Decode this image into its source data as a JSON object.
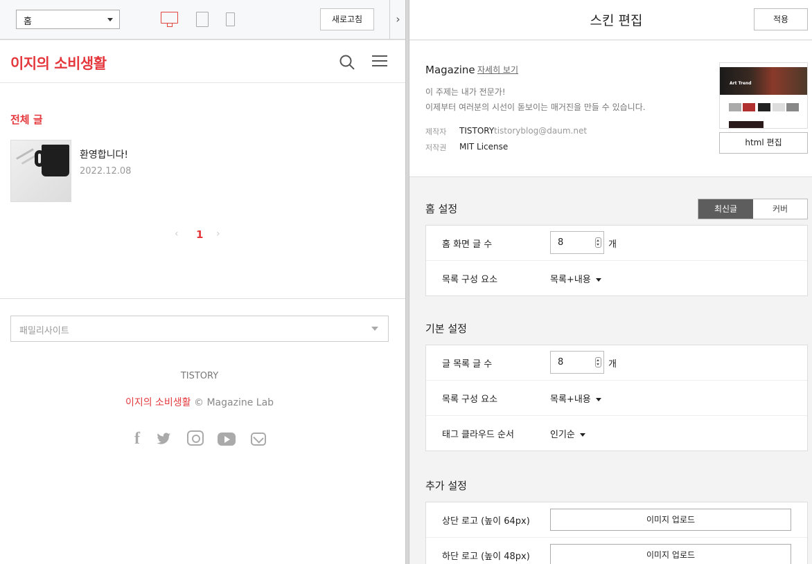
{
  "toolbar": {
    "page_select_value": "홈",
    "refresh_label": "새로고침",
    "collapse_glyph": "›"
  },
  "blog": {
    "title": "이지의 소비생활",
    "section_title": "전체 글",
    "posts": [
      {
        "title": "환영합니다!",
        "date": "2022.12.08"
      }
    ],
    "pager": {
      "prev": "‹",
      "current": "1",
      "next": "›"
    },
    "footer": {
      "family_site_placeholder": "패밀리사이트",
      "tistory": "TISTORY",
      "blog_name": "이지의 소비생활",
      "copyright": " © Magazine Lab"
    },
    "social_icons": [
      "facebook-icon",
      "twitter-icon",
      "instagram-icon",
      "youtube-icon",
      "mail-icon"
    ],
    "social_glyphs": {
      "facebook": "f",
      "twitter": "🐦"
    }
  },
  "editor": {
    "title": "스킨 편집",
    "apply_label": "적용",
    "theme": {
      "name": "Magazine",
      "more_link": "자세히 보기",
      "desc_line1": "이 주제는 내가 전문가!",
      "desc_line2": "이제부터 여러분의 시선이 돋보이는 매거진을 만들 수 있습니다.",
      "maker_label": "제작자",
      "maker_name": "TISTORY",
      "maker_email": "tistoryblog@daum.net",
      "license_label": "저작권",
      "license_value": "MIT License",
      "thumb_hero_text": "Art Trend",
      "html_edit_label": "html 편집"
    },
    "home_settings": {
      "title": "홈 설정",
      "toggle": [
        "최신글",
        "커버"
      ],
      "toggle_selected": "최신글",
      "rows": [
        {
          "label": "홈 화면 글 수",
          "value": "8",
          "unit": "개"
        },
        {
          "label": "목록 구성 요소",
          "value": "목록+내용"
        }
      ]
    },
    "basic_settings": {
      "title": "기본 설정",
      "rows": [
        {
          "label": "글 목록 글 수",
          "value": "8",
          "unit": "개"
        },
        {
          "label": "목록 구성 요소",
          "value": "목록+내용"
        },
        {
          "label": "태그 클라우드 순서",
          "value": "인기순"
        }
      ]
    },
    "extra_settings": {
      "title": "추가 설정",
      "rows": [
        {
          "label": "상단 로고 (높이 64px)",
          "button": "이미지 업로드"
        },
        {
          "label": "하단 로고 (높이 48px)",
          "button": "이미지 업로드"
        }
      ]
    }
  },
  "colors": {
    "brand_red": "#e4383d",
    "toggle_active_bg": "#5d5d5d",
    "panel_bg": "#f3f3f3"
  }
}
